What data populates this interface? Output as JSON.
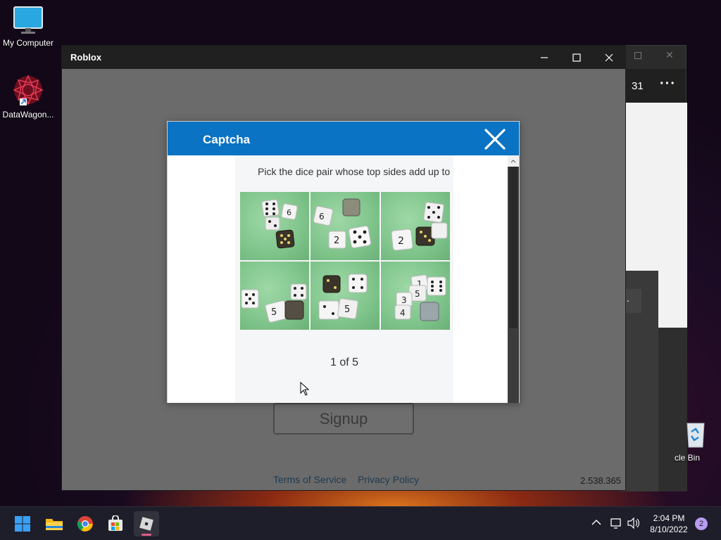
{
  "desktop": {
    "icons": [
      {
        "label": "My Computer",
        "icon": "monitor-icon"
      },
      {
        "label": "DataWagon...",
        "icon": "datawagon-shortcut-icon"
      },
      {
        "label": "cle Bin",
        "icon": "recycle-bin-icon"
      }
    ]
  },
  "background_window": {
    "counter_text": "31",
    "menu_glyph": "···",
    "dots_glyph": "··"
  },
  "roblox_window": {
    "title": "Roblox",
    "controls": {
      "minimize": "—",
      "maximize": "☐",
      "close": "✕"
    },
    "signup_label": "Signup",
    "links": {
      "terms": "Terms of Service",
      "privacy": "Privacy Policy"
    },
    "version": "2.538.365"
  },
  "captcha": {
    "title": "Captcha",
    "instruction": "Pick the dice pair whose top sides add up to",
    "progress_text": "1 of 5",
    "tiles": [
      {
        "name": "dice-tile-1"
      },
      {
        "name": "dice-tile-2"
      },
      {
        "name": "dice-tile-3"
      },
      {
        "name": "dice-tile-4"
      },
      {
        "name": "dice-tile-5"
      },
      {
        "name": "dice-tile-6"
      }
    ],
    "header_color": "#0a73c3"
  },
  "taskbar": {
    "apps": [
      "start-icon",
      "file-explorer-icon",
      "chrome-icon",
      "store-icon",
      "roblox-icon"
    ],
    "tray": {
      "chevron": "^"
    },
    "time": "2:04 PM",
    "date": "8/10/2022",
    "notification_count": "2"
  }
}
